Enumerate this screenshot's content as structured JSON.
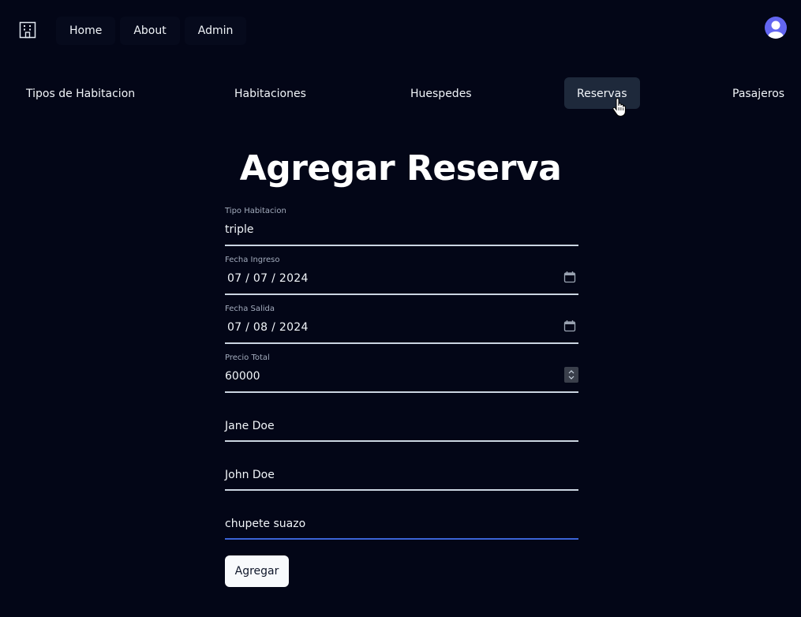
{
  "topnav": {
    "items": [
      "Home",
      "About",
      "Admin"
    ]
  },
  "subnav": {
    "items": [
      "Tipos de Habitacion",
      "Habitaciones",
      "Huespedes",
      "Reservas",
      "Pasajeros"
    ],
    "active": "Reservas"
  },
  "page": {
    "title": "Agregar Reserva"
  },
  "form": {
    "tipo_habitacion": {
      "label": "Tipo Habitacion",
      "value": "triple"
    },
    "fecha_ingreso": {
      "label": "Fecha Ingreso",
      "value": "07 / 07 / 2024"
    },
    "fecha_salida": {
      "label": "Fecha Salida",
      "value": "07 / 08 / 2024"
    },
    "precio_total": {
      "label": "Precio Total",
      "value": "60000"
    },
    "pasajeros": [
      "Jane Doe",
      "John Doe",
      "chupete suazo"
    ],
    "submit_label": "Agregar"
  },
  "icons": {
    "logo": "building-icon",
    "avatar": "user-avatar-icon",
    "calendar": "calendar-icon",
    "cursor": "hand-pointer-icon"
  },
  "colors": {
    "background": "#030617",
    "active_tab": "#1e293b",
    "avatar": "#6366f1",
    "focus_underline": "#3b63d6"
  }
}
